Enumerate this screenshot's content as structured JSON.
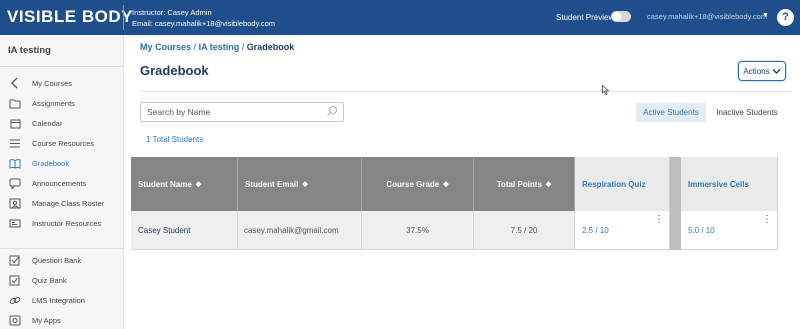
{
  "header": {
    "logo_text": "VISIBLE BODY",
    "instructor_line": "Instructor: Casey Admin",
    "email_line": "Email: casey.mahalik+18@visiblebody.com",
    "student_preview_label": "Student Preview",
    "student_preview_on": false,
    "user_email": "casey.mahalik+18@visiblebody.com",
    "help_label": "?"
  },
  "sidebar": {
    "course_title": "IA testing",
    "items": [
      {
        "label": "My Courses",
        "icon": "chevron-left-icon"
      },
      {
        "label": "Assignments",
        "icon": "folder-icon"
      },
      {
        "label": "Calendar",
        "icon": "calendar-icon"
      },
      {
        "label": "Course Resources",
        "icon": "list-icon"
      },
      {
        "label": "Gradebook",
        "icon": "book-icon",
        "active": true
      },
      {
        "label": "Announcements",
        "icon": "chat-icon"
      },
      {
        "label": "Manage Class Roster",
        "icon": "roster-icon"
      },
      {
        "label": "Instructor Resources",
        "icon": "id-card-icon"
      },
      {
        "label": "Question Bank",
        "icon": "checkbox-icon"
      },
      {
        "label": "Quiz Bank",
        "icon": "quiz-check-icon"
      },
      {
        "label": "LMS Integration",
        "icon": "link-icon"
      },
      {
        "label": "My Apps",
        "icon": "apps-icon"
      }
    ]
  },
  "breadcrumb": {
    "items": [
      "My Courses",
      "IA testing",
      "Gradebook"
    ],
    "separator": "/"
  },
  "page": {
    "title": "Gradebook",
    "actions_label": "Actions"
  },
  "search": {
    "placeholder": "Search by Name"
  },
  "filters": {
    "active_label": "Active Students",
    "inactive_label": "Inactive Students"
  },
  "total_students": "1 Total Students",
  "table": {
    "headers": {
      "student_name": "Student Name",
      "student_email": "Student Email",
      "course_grade": "Course Grade",
      "total_points": "Total Points",
      "quiz_1": "Respiration Quiz",
      "quiz_2": "Immersive Cells"
    },
    "rows": [
      {
        "student_name": "Casey Student",
        "student_email": "casey.mahalik@gmail.com",
        "course_grade": "37.5%",
        "total_points": "7.5 / 20",
        "quiz_1": "2.5 / 10",
        "quiz_2": "5.0 / 10"
      }
    ]
  },
  "colors": {
    "header_bg": "#1f4e8c",
    "accent": "#2b7bbd",
    "table_header": "#858585"
  }
}
